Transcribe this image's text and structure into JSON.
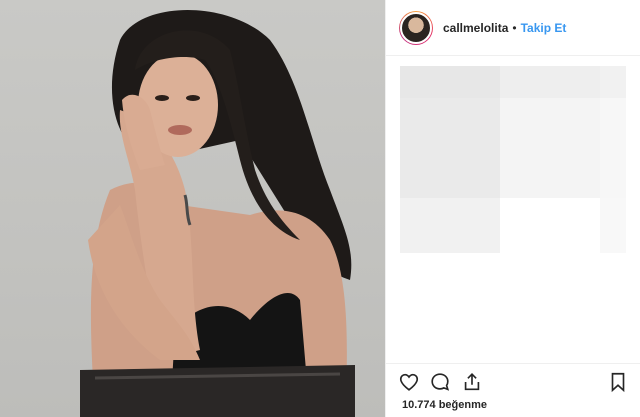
{
  "header": {
    "username": "callmelolita",
    "separator": "•",
    "follow_label": "Takip Et"
  },
  "actions": {
    "like_icon": "heart-icon",
    "comment_icon": "comment-icon",
    "share_icon": "share-icon",
    "save_icon": "bookmark-icon"
  },
  "likes": {
    "text": "10.774 beğenme"
  },
  "colors": {
    "link": "#3897f0",
    "text": "#262626",
    "placeholder_dark": "#e7e7e7",
    "placeholder_light": "#f2f2f2"
  }
}
